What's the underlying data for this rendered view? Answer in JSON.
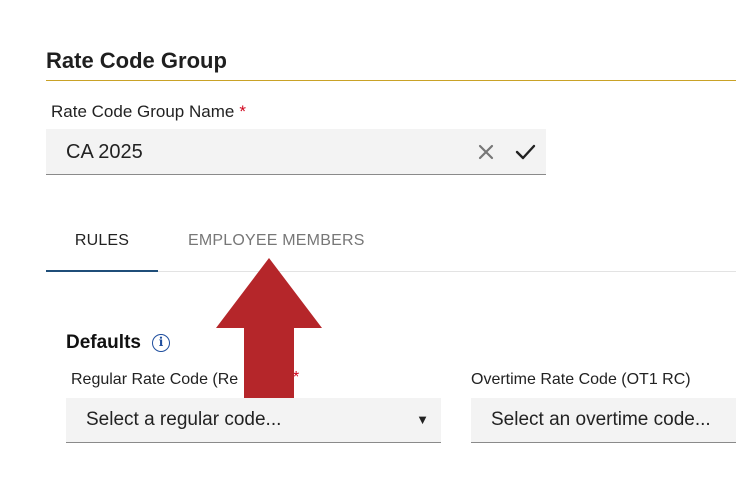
{
  "section": {
    "title": "Rate Code Group"
  },
  "name_field": {
    "label": "Rate Code Group Name",
    "required_mark": "*",
    "value": "CA 2025",
    "clear_icon": "close-icon",
    "confirm_icon": "check-icon"
  },
  "tabs": [
    {
      "label": "RULES",
      "active": true
    },
    {
      "label": "EMPLOYEE MEMBERS",
      "active": false
    }
  ],
  "defaults": {
    "title": "Defaults",
    "info_icon": "info-icon",
    "info_glyph": "i",
    "regular": {
      "label": "Regular Rate Code (Re",
      "required_mark": "*",
      "placeholder": "Select a regular code...",
      "caret": "▼"
    },
    "overtime": {
      "label": "Overtime Rate Code (OT1 RC)",
      "placeholder": "Select an overtime code..."
    }
  },
  "annotation": {
    "icon": "red-up-arrow",
    "color": "#b5262a"
  },
  "colors": {
    "accent_rule": "#c9a227",
    "active_tab": "#1f4e79",
    "info": "#1f4e9e",
    "required": "#d0021b"
  }
}
